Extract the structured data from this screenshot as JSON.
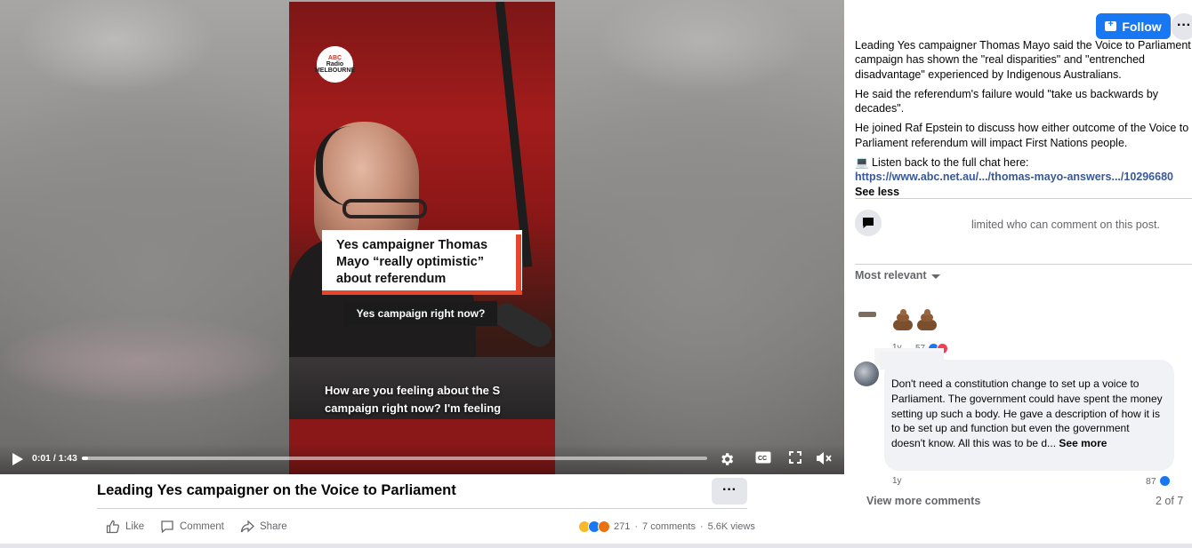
{
  "video": {
    "station_logo_top": "ABC",
    "station_logo_middle": "Radio",
    "station_logo_bottom": "MELBOURNE",
    "caption_card": "Yes campaigner Thomas Mayo “really optimistic” about referendum",
    "subtitle_chip": "Yes campaign right now?",
    "subtitle": "How are you feeling about the S campaign right now? I'm feeling",
    "time": "0:01 / 1:43",
    "progress_fraction": 0.01
  },
  "post": {
    "title": "Leading Yes campaigner on the Voice to Parliament",
    "more_label": "···",
    "actions": {
      "like": "Like",
      "comment": "Comment",
      "share": "Share"
    },
    "reaction_count": "271",
    "comments_count": "7 comments",
    "views": "5.6K views"
  },
  "panel": {
    "follow_label": "Follow",
    "more_label": "···",
    "paragraph1": "Leading Yes campaigner Thomas Mayo said the Voice to Parliament campaign has shown the \"real disparities\" and \"entrenched disadvantage\" experienced by Indigenous Australians.",
    "paragraph2": "He said the referendum's failure would \"take us backwards by decades\".",
    "paragraph3": "He joined Raf Epstein to discuss how either outcome of the Voice to Parliament referendum will impact First Nations people.",
    "listen_prefix": "💻 Listen back to the full chat here:",
    "link": "https://www.abc.net.au/.../thomas-mayo-answers.../10296680",
    "see_less": "See less",
    "limited_text": "limited who can comment on this post.",
    "sort_label": "Most relevant",
    "comment1": {
      "time": "1y",
      "reactions": "57"
    },
    "comment2": {
      "text": "Don't need a constitution change to set up a voice to Parliament. The government could have spent the money setting up such a body. He gave a description of how it is to be set up and function but even the government doesn't know. All this was to be d...",
      "see_more": "See more",
      "time": "1y",
      "reactions": "87"
    },
    "view_more": "View more comments",
    "pager": "2 of 7"
  },
  "colors": {
    "accent": "#1877f2",
    "caption_accent": "#e6462c",
    "muted": "#65676b"
  }
}
